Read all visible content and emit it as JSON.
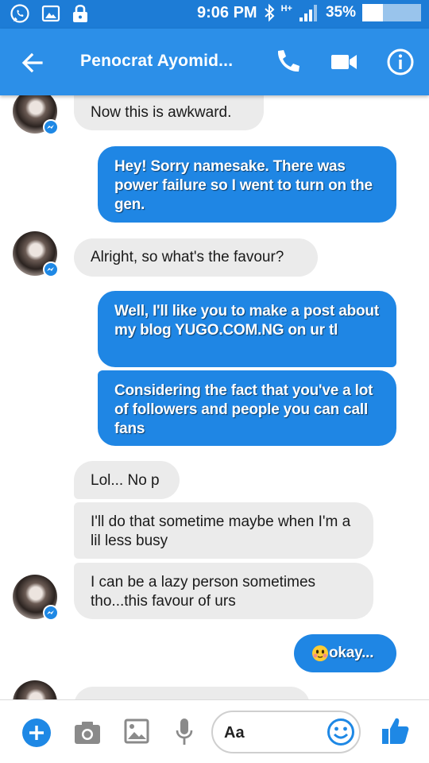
{
  "status_bar": {
    "time": "9:06 PM",
    "network": "H+",
    "battery_percent": "35%",
    "battery_level": 0.35,
    "icons": [
      "whatsapp-icon",
      "image-icon",
      "lock-icon",
      "bluetooth-icon",
      "signal-icon"
    ]
  },
  "header": {
    "title": "Penocrat Ayomid...",
    "icons": [
      "back-arrow-icon",
      "phone-icon",
      "video-camera-icon",
      "info-icon"
    ]
  },
  "messages": [
    {
      "from": "them",
      "text": "Now this is awkward."
    },
    {
      "from": "me",
      "text": "Hey! Sorry namesake. There was power failure so I went to turn on the gen."
    },
    {
      "from": "them",
      "text": "Alright, so what's the favour?"
    },
    {
      "from": "me",
      "text": "Well, I'll like you to make a post about my blog YUGO.COM.NG on ur tl"
    },
    {
      "from": "me",
      "text": "Considering the fact that you've a lot of followers and people you can call fans"
    },
    {
      "from": "them",
      "text": "Lol... No p"
    },
    {
      "from": "them",
      "text": "I'll do that sometime maybe when I'm a lil less busy"
    },
    {
      "from": "them",
      "text": "I can be a lazy person sometimes tho...this favour of urs"
    },
    {
      "from": "me",
      "text": "okay...",
      "emoji": "face-emoji"
    }
  ],
  "composer": {
    "placeholder": "Aa",
    "icons": [
      "plus-icon",
      "camera-icon",
      "gallery-icon",
      "microphone-icon",
      "smiley-icon",
      "thumbs-up-icon"
    ]
  },
  "colors": {
    "header": "#2c8fe8",
    "status_bar": "#1d7cd6",
    "outgoing_bubble": "#1f86e4",
    "incoming_bubble": "#ebebeb",
    "accent": "#1e88e5"
  }
}
